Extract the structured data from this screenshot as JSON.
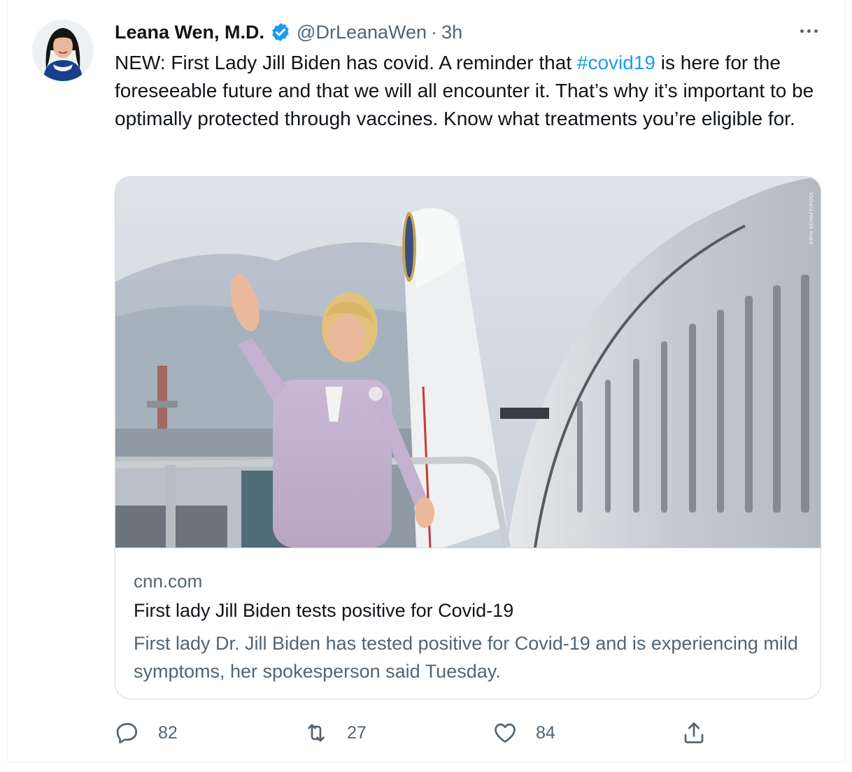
{
  "tweet": {
    "author_name": "Leana Wen, M.D.",
    "handle": "@DrLeanaWen",
    "separator": "·",
    "time": "3h",
    "text_before_hashtag": "NEW: First Lady Jill Biden has covid. A reminder that ",
    "hashtag": "#covid19",
    "text_after_hashtag": " is here for the foreseeable future and that we will all encounter it. That’s why it’s important to be optimally protected through vaccines. Know what treatments you’re eligible for."
  },
  "card": {
    "domain": "cnn.com",
    "title": "First lady Jill Biden tests positive for Covid-19",
    "description": "First lady Dr. Jill Biden has tested positive for Covid-19 and is experiencing mild symptoms, her spokesperson said Tuesday.",
    "image_credit": "ERIN SCHAFF/POOL"
  },
  "actions": {
    "replies": "82",
    "retweets": "27",
    "likes": "84"
  },
  "icons": {
    "verified": "verified-badge-icon",
    "more": "more-dots-icon",
    "reply": "reply-icon",
    "retweet": "retweet-icon",
    "like": "heart-icon",
    "share": "share-icon"
  },
  "colors": {
    "accent": "#1d9bf0",
    "secondary_text": "#536471",
    "primary_text": "#0f1419",
    "border": "#cfd9de"
  }
}
